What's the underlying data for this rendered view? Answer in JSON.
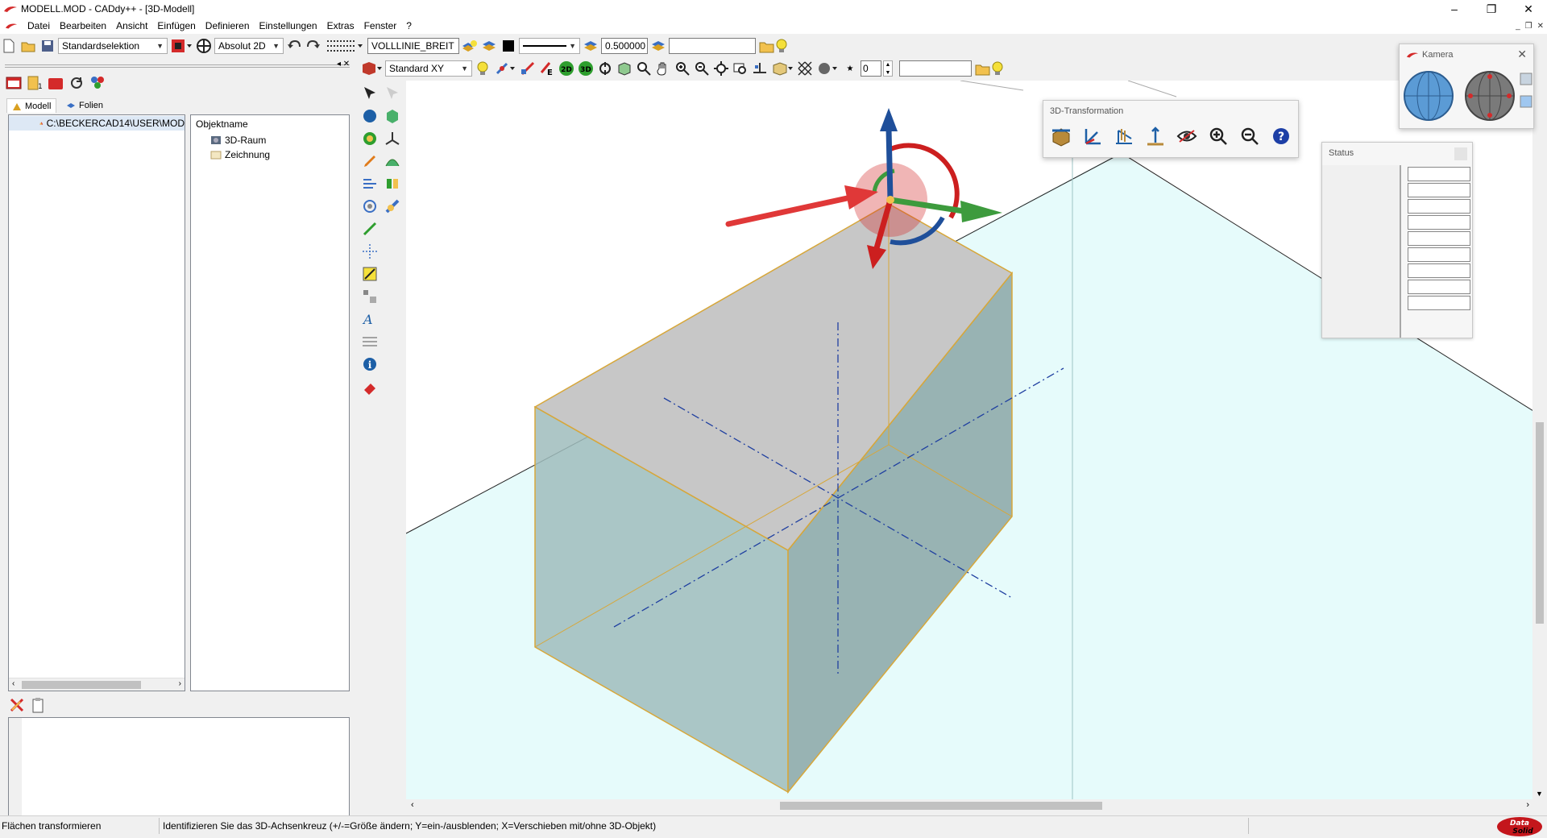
{
  "window": {
    "title": "MODELL.MOD  -  CADdy++ - [3D-Modell]",
    "controls": {
      "minimize": "–",
      "maximize": "❐",
      "close": "✕"
    }
  },
  "menu": {
    "items": [
      "Datei",
      "Bearbeiten",
      "Ansicht",
      "Einfügen",
      "Definieren",
      "Einstellungen",
      "Extras",
      "Fenster",
      "?"
    ]
  },
  "toolbar1": {
    "selection_mode": "Standardselektion",
    "coord_mode": "Absolut 2D",
    "linetype": "VOLLLINIE_BREIT",
    "linewidth": "0.500000",
    "layer_field": ""
  },
  "toolbar2": {
    "view": "Standard XY",
    "view2d_label": "2D",
    "view3d_label": "3D",
    "spin_value": "0",
    "empty_field": ""
  },
  "left_panel": {
    "tabs": [
      "Modell",
      "Folien"
    ],
    "path": "C:\\BECKERCAD14\\USER\\MOD",
    "objects_header": "Objektname",
    "objects": [
      "3D-Raum",
      "Zeichnung"
    ]
  },
  "floating": {
    "transform_title": "3D-Transformation",
    "camera_title": "Kamera",
    "status_title": "Status"
  },
  "statusbar": {
    "mode": "Flächen transformieren",
    "hint": "Identifizieren Sie das 3D-Achsenkreuz (+/-=Größe ändern; Y=ein-/ausblenden; X=Verschieben mit/ohne 3D-Objekt)"
  },
  "brand": {
    "line1": "Data",
    "line2": "Solid"
  },
  "colors": {
    "accent_red": "#d42a2a",
    "floor": "#e6fbfb",
    "box_face": "#9fbcbc",
    "box_edge": "#d7a73a",
    "axis_blue": "#1f4f9a",
    "axis_green": "#3d9b3d"
  }
}
